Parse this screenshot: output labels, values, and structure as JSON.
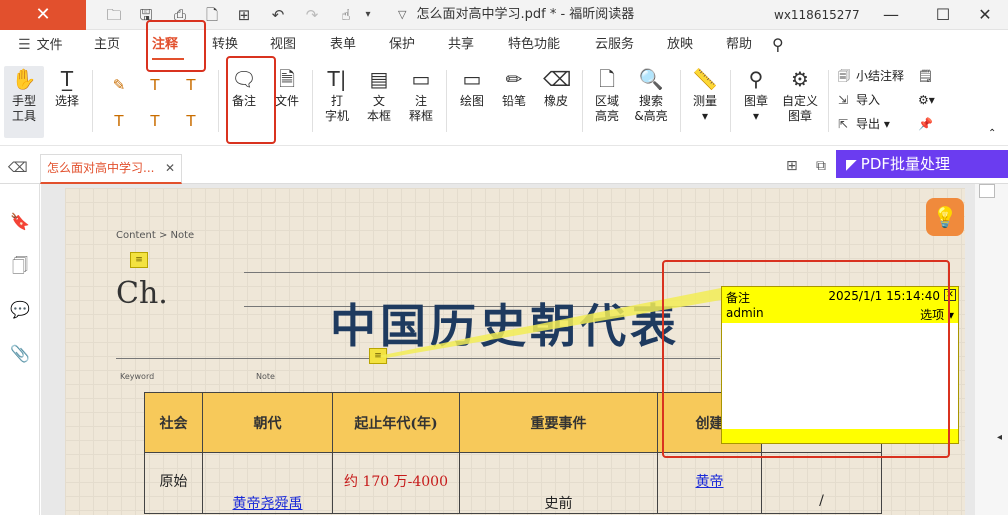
{
  "titlebar": {
    "title": "怎么面对高中学习.pdf * - 福昕阅读器",
    "user": "wx118615277"
  },
  "menu": {
    "file": "文件",
    "items": [
      "主页",
      "注释",
      "转换",
      "视图",
      "表单",
      "保护",
      "共享",
      "特色功能",
      "云服务",
      "放映",
      "帮助"
    ],
    "active": "注释"
  },
  "ribbon": {
    "hand": "手型\n工具",
    "select": "选择",
    "note": "备注",
    "file": "文件",
    "typewriter": "打\n字机",
    "textbox": "文\n本框",
    "callout": "注\n释框",
    "drawing": "绘图",
    "pencil": "铅笔",
    "eraser": "橡皮",
    "area_highlight": "区域\n高亮",
    "search_highlight": "搜索\n&高亮",
    "measure": "测量",
    "stamp": "图章",
    "custom_stamp": "自定义\n图章",
    "summarize": "小结注释",
    "import": "导入",
    "export": "导出"
  },
  "tabs": {
    "doc_tab": "怎么面对高中学习...",
    "batch": "PDF批量处理"
  },
  "page": {
    "crumb": "Content > Note",
    "ch": "Ch.",
    "title": "中国历史朝代表",
    "keyword": "Keyword",
    "note": "Note",
    "table_headers": [
      "社会",
      "朝代",
      "起止年代(年)",
      "重要事件",
      "创建"
    ],
    "row1": {
      "society": "原始",
      "years": "约 170 万-4000",
      "founder": "黄帝"
    },
    "row2": {
      "dynasty": "黄帝尧舜禹",
      "event": "史前",
      "mark": "/"
    }
  },
  "popup": {
    "label": "备注",
    "datetime": "2025/1/1 15:14:40",
    "author": "admin",
    "options": "选项"
  },
  "colors": {
    "brand": "#e2502d",
    "batch": "#6b3cf0",
    "note_yellow": "#ffff00",
    "table_header": "#f7c95a",
    "highlight_box": "#d9321f"
  }
}
